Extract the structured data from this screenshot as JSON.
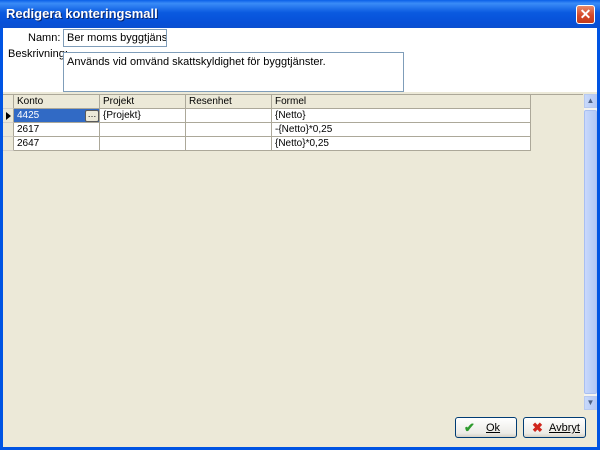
{
  "window": {
    "title": "Redigera konteringsmall",
    "close_glyph": "✕"
  },
  "form": {
    "name_label": "Namn:",
    "name_value": "Ber moms byggtjänst",
    "description_label": "Beskrivning:",
    "description_value": "Används vid omvänd skattskyldighet för byggtjänster."
  },
  "grid": {
    "columns": [
      "Konto",
      "Projekt",
      "Resenhet",
      "Formel"
    ],
    "rows": [
      {
        "konto": "4425",
        "projekt": "{Projekt}",
        "resenhet": "",
        "formel": "{Netto}"
      },
      {
        "konto": "2617",
        "projekt": "",
        "resenhet": "",
        "formel": "-{Netto}*0,25"
      },
      {
        "konto": "2647",
        "projekt": "",
        "resenhet": "",
        "formel": "{Netto}*0,25"
      }
    ],
    "ellipsis_glyph": "…"
  },
  "buttons": {
    "ok_label": "Ok",
    "ok_icon": "✔",
    "cancel_label": "Avbryt",
    "cancel_icon": "✖"
  },
  "colors": {
    "ok_icon": "#2e9b2e",
    "cancel_icon": "#d0261d",
    "selection": "#316ac5"
  }
}
